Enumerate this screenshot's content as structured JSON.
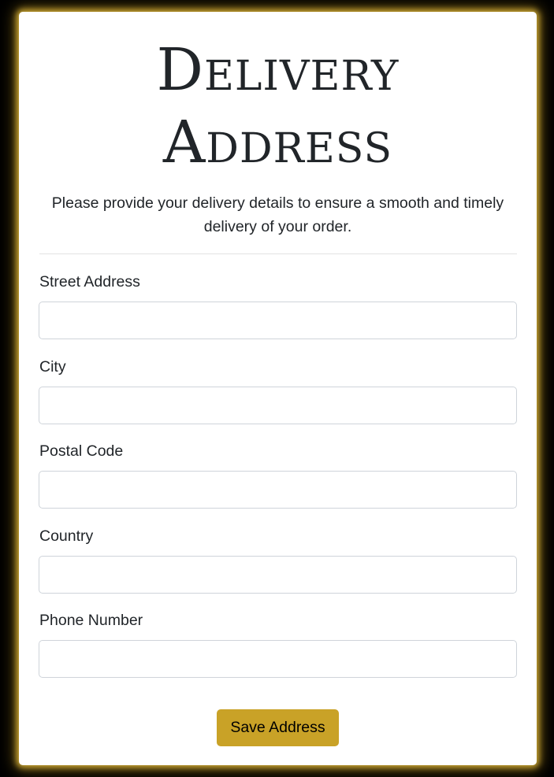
{
  "page": {
    "title_line1": "Delivery",
    "title_line2": "Address",
    "subtitle": "Please provide your delivery details to ensure a smooth and timely delivery of your order."
  },
  "form": {
    "fields": [
      {
        "label": "Street Address",
        "value": "",
        "placeholder": ""
      },
      {
        "label": "City",
        "value": "",
        "placeholder": ""
      },
      {
        "label": "Postal Code",
        "value": "",
        "placeholder": ""
      },
      {
        "label": "Country",
        "value": "",
        "placeholder": ""
      },
      {
        "label": "Phone Number",
        "value": "",
        "placeholder": ""
      }
    ],
    "submit_label": "Save Address"
  },
  "colors": {
    "background": "#000000",
    "card": "#ffffff",
    "glow": "#d4af37",
    "button": "#c9a227",
    "text": "#212529"
  }
}
